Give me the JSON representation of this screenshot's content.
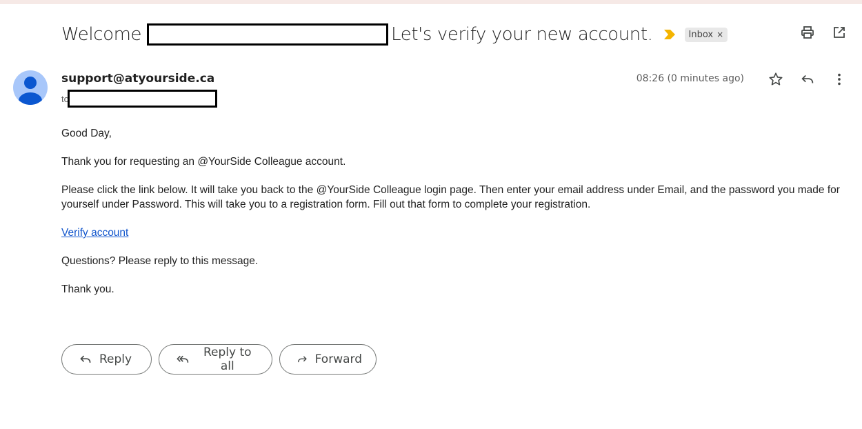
{
  "subject": {
    "prefix": "Welcome",
    "suffix": "Let's verify your new account.",
    "label_chip": "Inbox",
    "chip_close": "×"
  },
  "icons": {
    "importance": "importance-marker-icon",
    "print": "print-icon",
    "open_new_window": "open-in-new-window-icon",
    "star": "star-icon",
    "reply": "reply-icon",
    "more": "more-vertical-icon",
    "avatar": "person-avatar-icon"
  },
  "colors": {
    "importance": "#f4b400",
    "avatar_bg": "#a8c7fa",
    "avatar_fg": "#0b57d0",
    "link": "#1155cc"
  },
  "message": {
    "sender": "support@atyourside.ca",
    "to_label": "to",
    "timestamp": "08:26 (0 minutes ago)",
    "greeting": "Good Day,",
    "para1": "Thank you for requesting an @YourSide Colleague account.",
    "para2": "Please click the link below. It will take you back to the @YourSide Colleague login page. Then enter your email address under Email, and the password you made for yourself under Password. This will take you to a registration form. Fill out that form to complete your registration.",
    "link_text": "Verify account",
    "para3": "Questions? Please reply to this message.",
    "closing": "Thank you."
  },
  "actions": {
    "reply": "Reply",
    "reply_all": "Reply to all",
    "forward": "Forward"
  }
}
